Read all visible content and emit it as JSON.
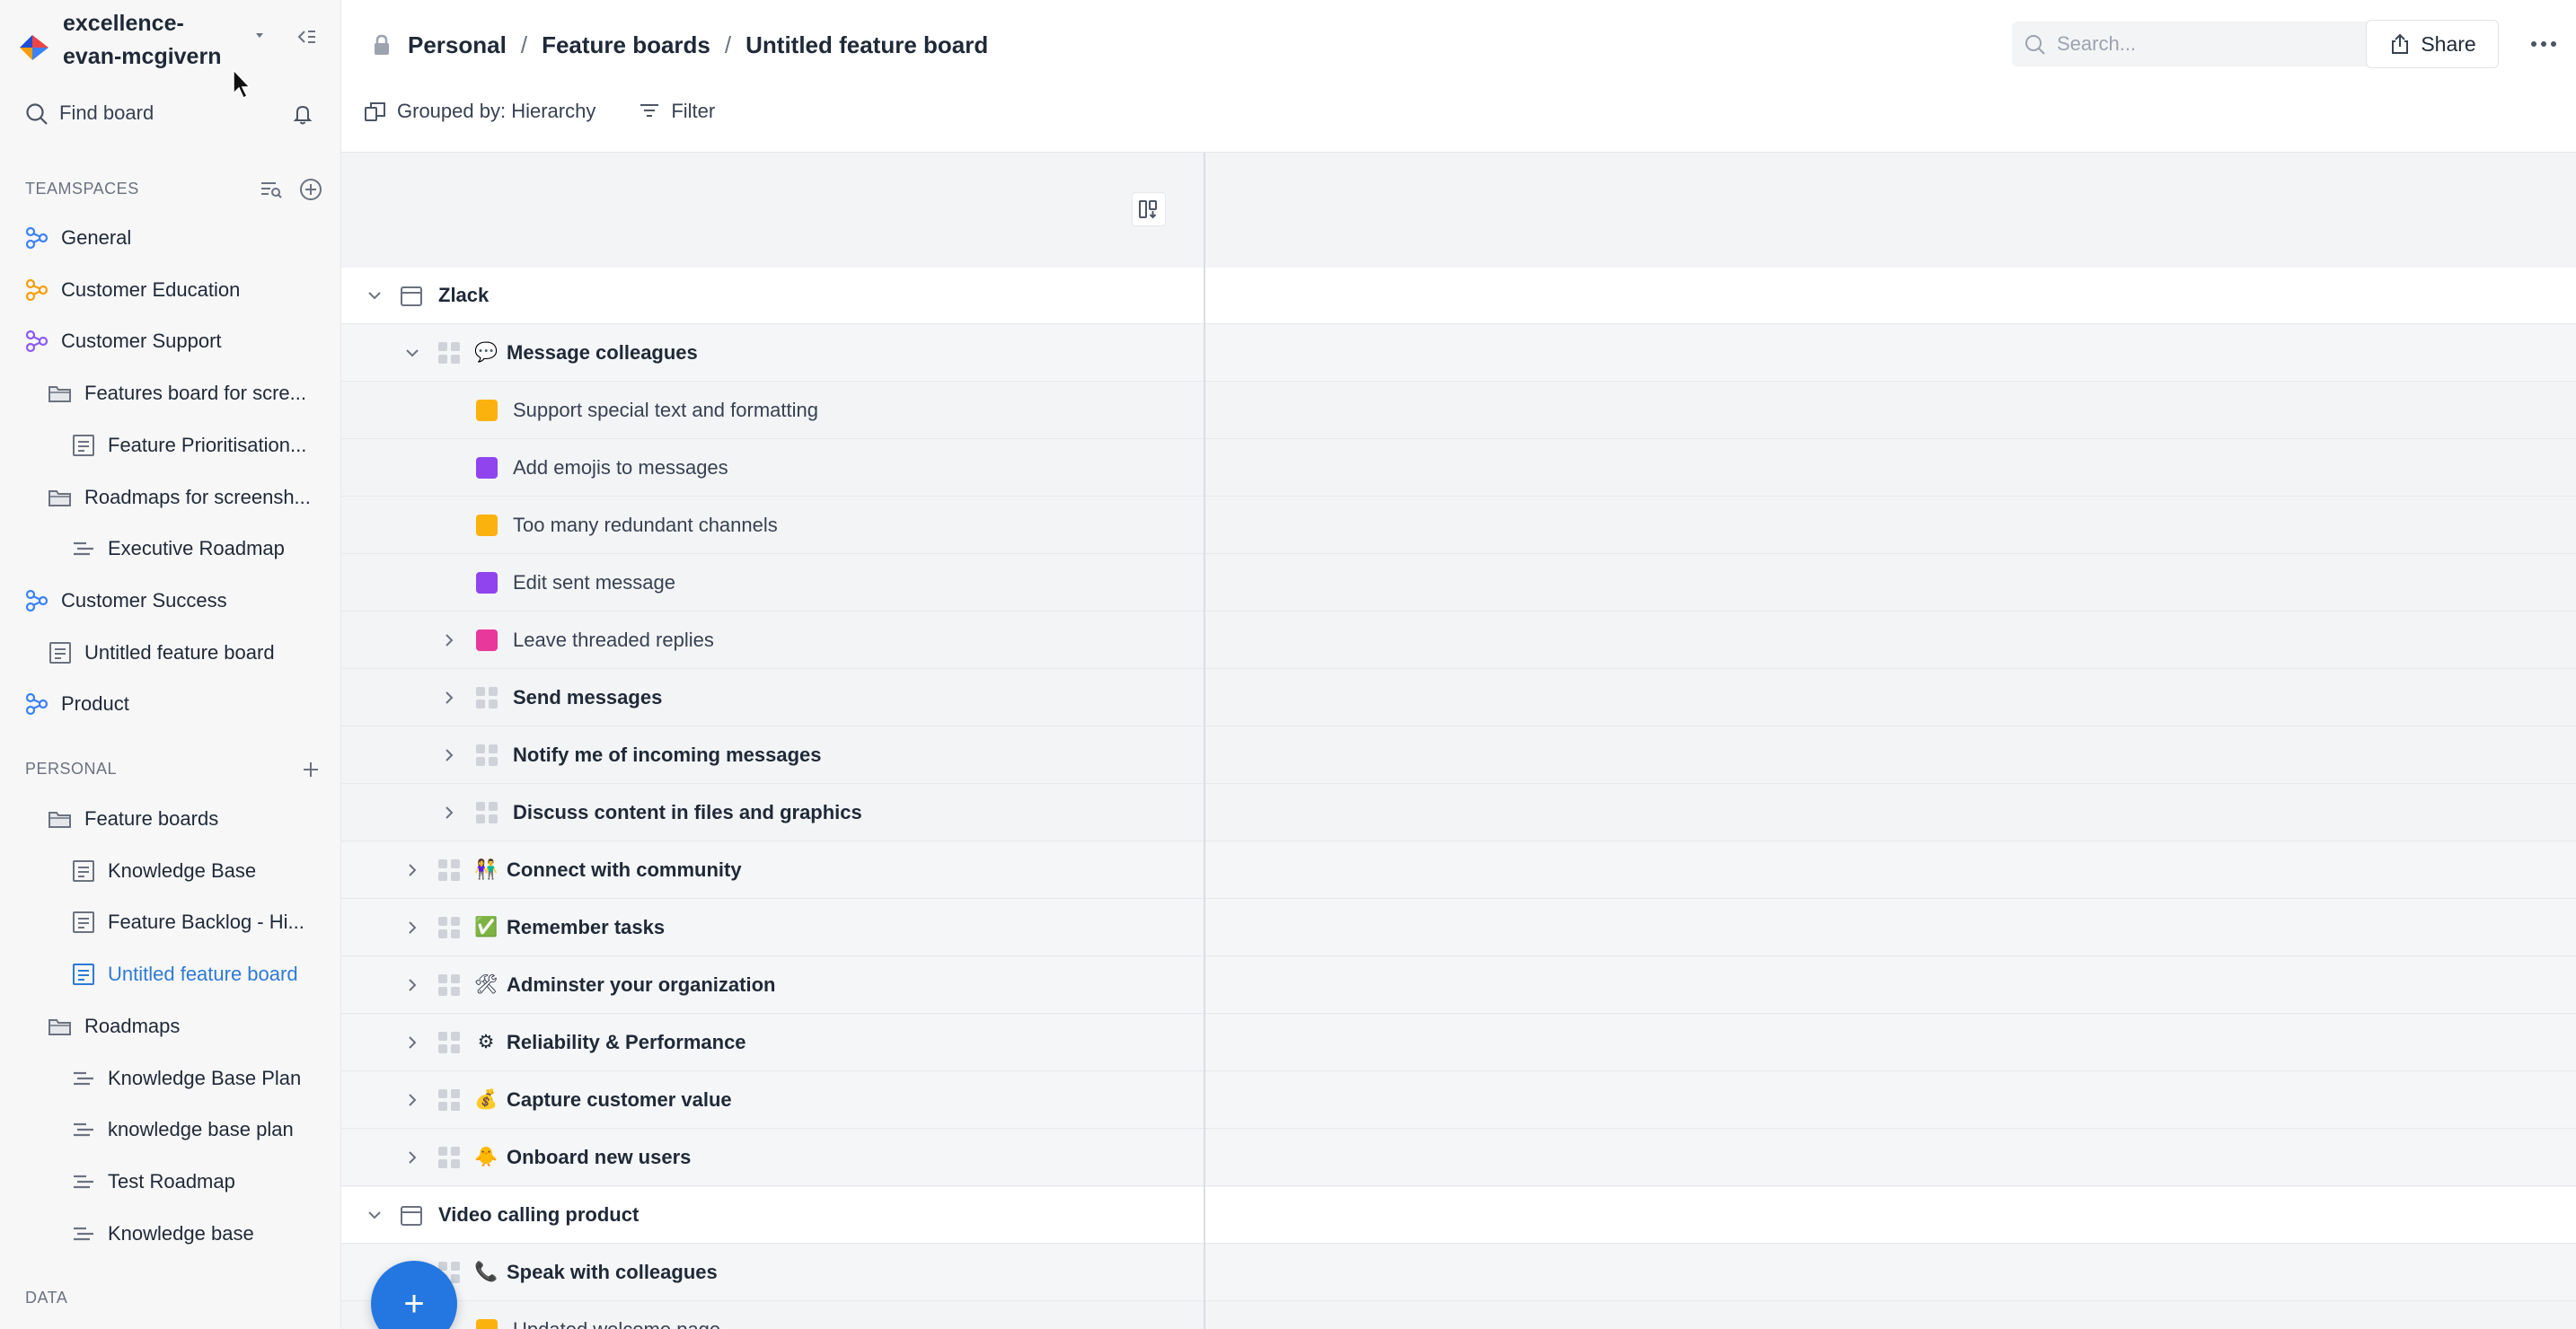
{
  "sidebar": {
    "workspace_name": "excellence-evan-mcgivern",
    "find_label": "Find board",
    "teamspaces_label": "TEAMSPACES",
    "personal_label": "PERSONAL",
    "data_label": "DATA",
    "teamspace_items": [
      {
        "label": "General",
        "icon": "teamspace-icon",
        "color": "#3b82f6"
      },
      {
        "label": "Customer Education",
        "icon": "teamspace-icon",
        "color": "#f59e0b"
      },
      {
        "label": "Customer Support",
        "icon": "teamspace-icon",
        "color": "#8b5cf6"
      },
      {
        "label": "Features board for scre...",
        "icon": "folder-icon"
      },
      {
        "label": "Feature Prioritisation...",
        "icon": "board-icon"
      },
      {
        "label": "Roadmaps for screensh...",
        "icon": "folder-icon"
      },
      {
        "label": "Executive Roadmap",
        "icon": "roadmap-icon"
      },
      {
        "label": "Customer Success",
        "icon": "teamspace-icon",
        "color": "#3b82f6"
      },
      {
        "label": "Untitled feature board",
        "icon": "board-icon"
      },
      {
        "label": "Product",
        "icon": "teamspace-icon",
        "color": "#3b82f6"
      }
    ],
    "personal_items": [
      {
        "label": "Feature boards",
        "icon": "folder-icon"
      },
      {
        "label": "Knowledge Base",
        "icon": "board-icon"
      },
      {
        "label": "Feature Backlog - Hi...",
        "icon": "board-icon"
      },
      {
        "label": "Untitled feature board",
        "icon": "board-icon",
        "active": true
      },
      {
        "label": "Roadmaps",
        "icon": "folder-icon"
      },
      {
        "label": "Knowledge Base Plan",
        "icon": "roadmap-icon"
      },
      {
        "label": "knowledge base plan",
        "icon": "roadmap-icon"
      },
      {
        "label": "Test Roadmap",
        "icon": "roadmap-icon"
      },
      {
        "label": "Knowledge base",
        "icon": "roadmap-icon"
      }
    ]
  },
  "header": {
    "breadcrumb": [
      "Personal",
      "Feature boards",
      "Untitled feature board"
    ],
    "search_placeholder": "Search...",
    "share_label": "Share",
    "grouped_by_label": "Grouped by: Hierarchy",
    "filter_label": "Filter"
  },
  "board": {
    "rows": [
      {
        "label": "Zlack",
        "level": "product",
        "expanded": true
      },
      {
        "label": "Message colleagues",
        "level": "component",
        "expanded": true,
        "emoji": "💬"
      },
      {
        "label": "Support special text and formatting",
        "level": "feature",
        "status_color": "#fbb20f"
      },
      {
        "label": "Add emojis to messages",
        "level": "feature",
        "status_color": "#8f44ee"
      },
      {
        "label": "Too many redundant channels",
        "level": "feature",
        "status_color": "#fbb20f"
      },
      {
        "label": "Edit sent message",
        "level": "feature",
        "status_color": "#8f44ee"
      },
      {
        "label": "Leave threaded replies",
        "level": "feature",
        "status_color": "#e8389b",
        "collapsible": true
      },
      {
        "label": "Send messages",
        "level": "subcomponent"
      },
      {
        "label": "Notify me of incoming messages",
        "level": "subcomponent"
      },
      {
        "label": "Discuss content in files and graphics",
        "level": "subcomponent"
      },
      {
        "label": "Connect with community",
        "level": "component",
        "emoji": "👫"
      },
      {
        "label": "Remember tasks",
        "level": "component",
        "emoji": "✅"
      },
      {
        "label": "Adminster your organization",
        "level": "component",
        "emoji": "🛠"
      },
      {
        "label": "Reliability & Performance",
        "level": "component",
        "emoji": "⚙"
      },
      {
        "label": "Capture customer value",
        "level": "component",
        "emoji": "💰"
      },
      {
        "label": "Onboard new users",
        "level": "component",
        "emoji": "🐥"
      },
      {
        "label": "Video calling product",
        "level": "product",
        "expanded": true
      },
      {
        "label": "Speak with colleagues",
        "level": "component",
        "emoji": "📞"
      },
      {
        "label": "Updated welcome page",
        "level": "feature",
        "status_color": "#fbb20f"
      }
    ]
  },
  "fab_label": "+",
  "colors": {
    "accent": "#2477e0",
    "active_nav": "#2f7ad6",
    "status_yellow": "#fbb20f",
    "status_purple": "#8f44ee",
    "status_pink": "#e8389b"
  }
}
